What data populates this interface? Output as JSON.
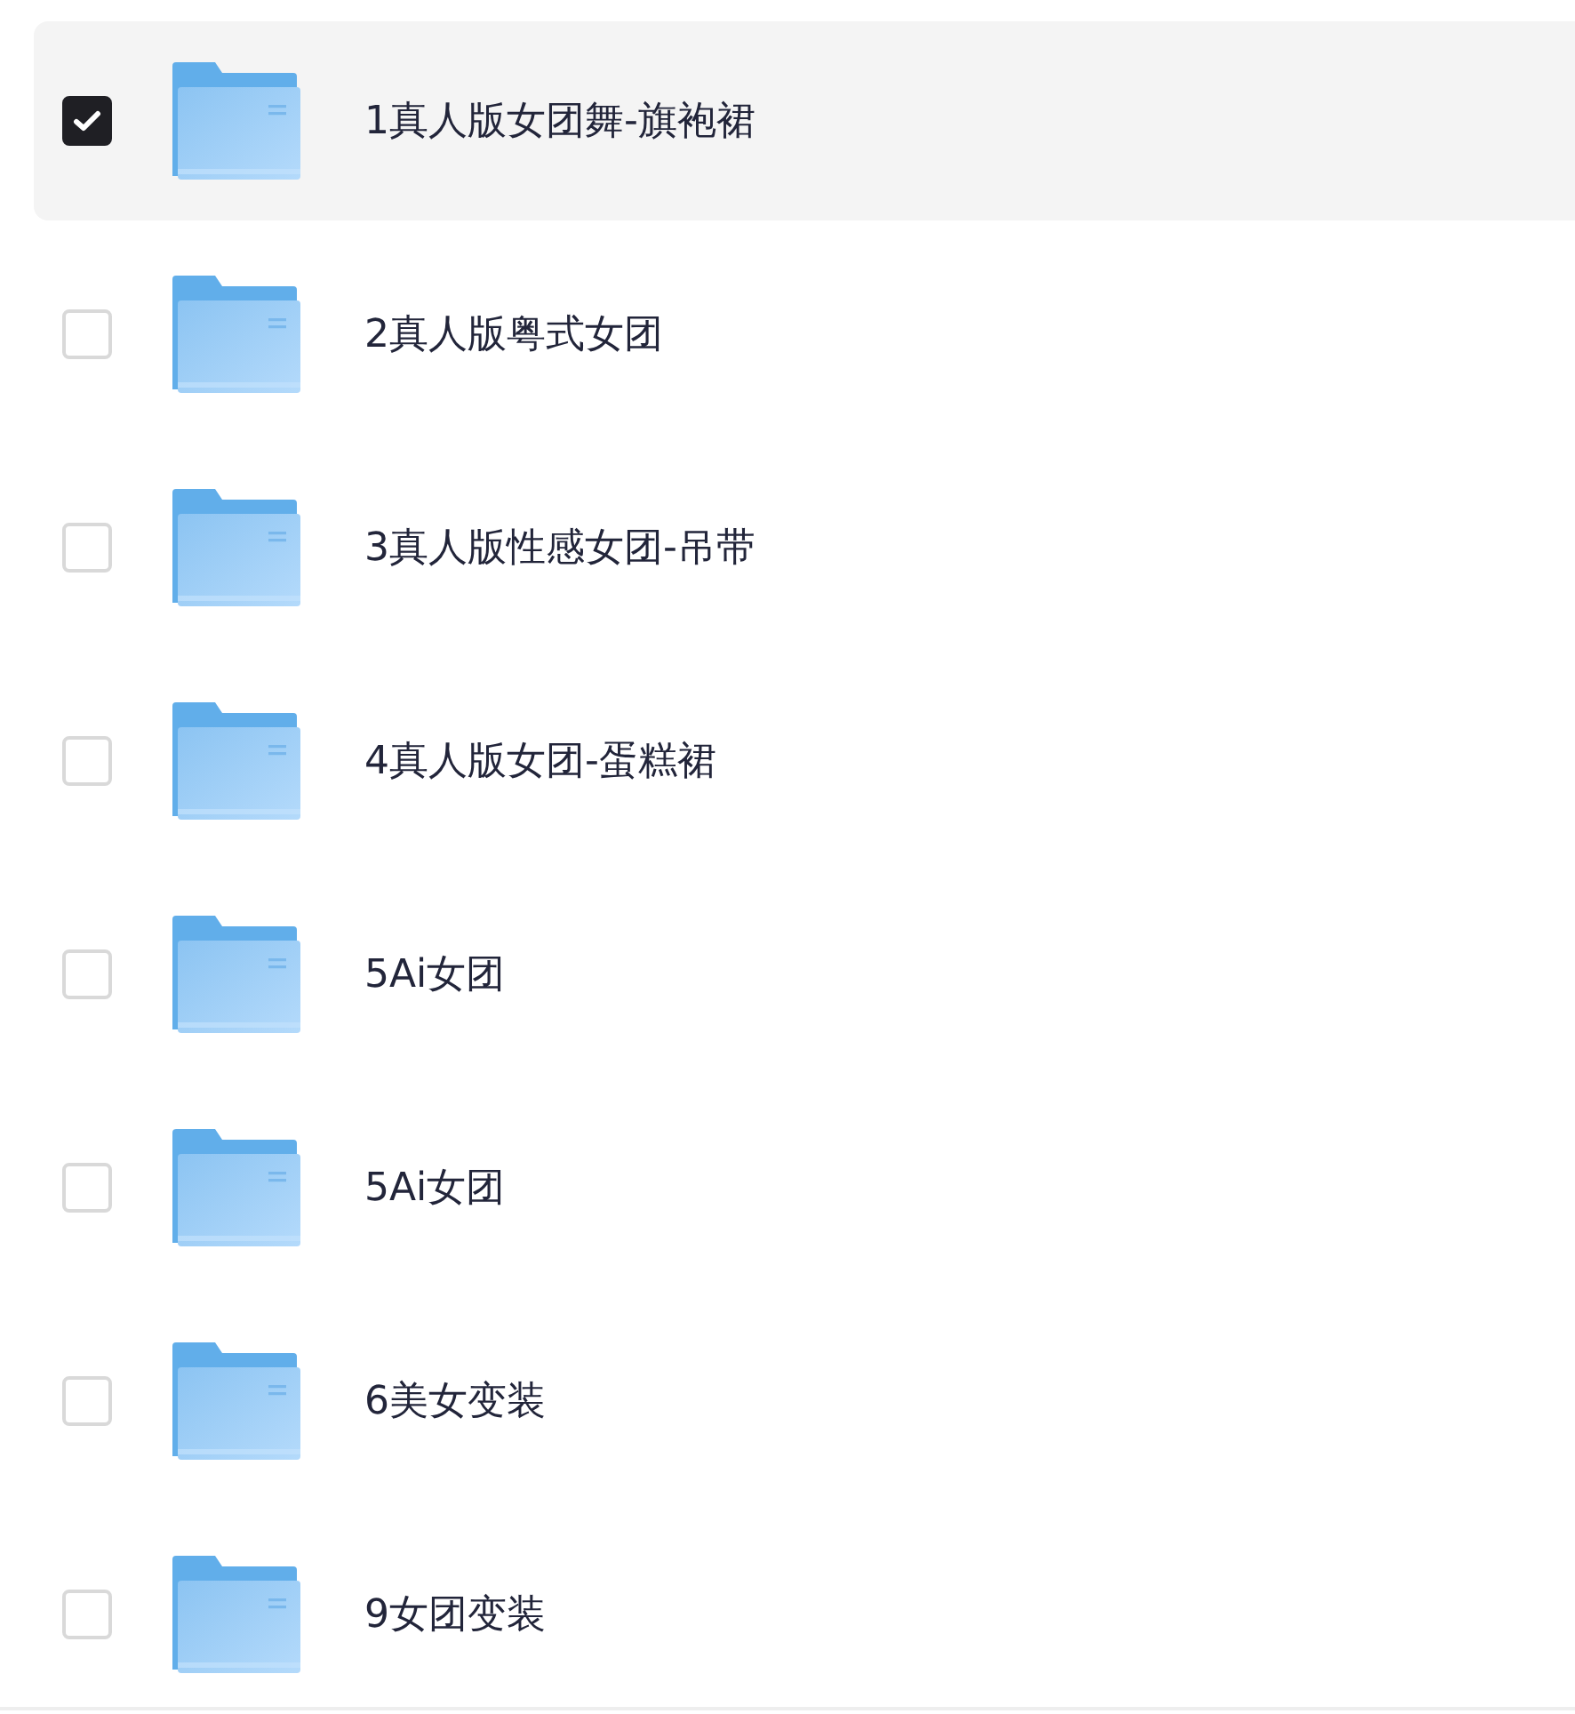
{
  "files": [
    {
      "name": "1真人版女团舞-旗袍裙",
      "checked": true
    },
    {
      "name": "2真人版粤式女团",
      "checked": false
    },
    {
      "name": "3真人版性感女团-吊带",
      "checked": false
    },
    {
      "name": "4真人版女团-蛋糕裙",
      "checked": false
    },
    {
      "name": "5Ai女团",
      "checked": false
    },
    {
      "name": "5Ai女团",
      "checked": false
    },
    {
      "name": "6美女变装",
      "checked": false
    },
    {
      "name": "9女团变装",
      "checked": false
    }
  ]
}
